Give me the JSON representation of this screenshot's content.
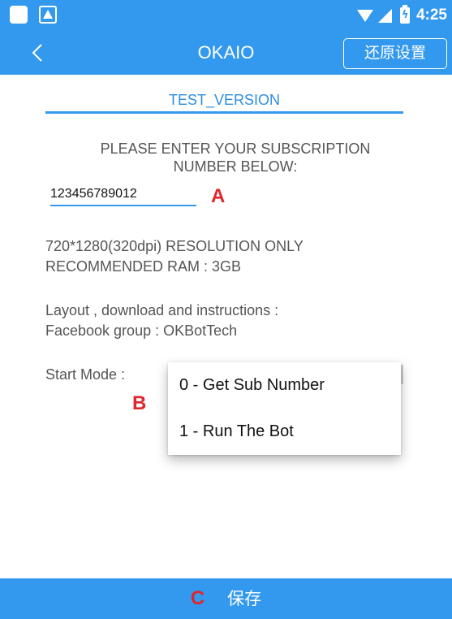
{
  "status_bar": {
    "time": "4:25",
    "icons": [
      "app-square-icon",
      "notification-icon",
      "wifi-icon",
      "signal-icon",
      "battery-icon"
    ]
  },
  "app_bar": {
    "title": "OKAIO",
    "back_icon": "chevron-left-icon",
    "reset_label": "还原设置"
  },
  "form": {
    "version_label": "TEST_VERSION",
    "instruction_line1": "PLEASE ENTER YOUR SUBSCRIPTION",
    "instruction_line2": "NUMBER BELOW:",
    "subscription_value": "123456789012",
    "resolution_note": "720*1280(320dpi) RESOLUTION ONLY",
    "ram_note": "RECOMMENDED RAM : 3GB",
    "layout_note": "Layout , download and instructions :",
    "facebook_note": "Facebook group : OKBotTech",
    "start_mode_label": "Start Mode  :"
  },
  "dropdown": {
    "options": [
      "0 - Get Sub Number",
      "1 - Run The Bot"
    ]
  },
  "markers": {
    "a": "A",
    "b": "B",
    "c": "C"
  },
  "footer": {
    "save_label": "保存"
  },
  "colors": {
    "primary": "#3399ee",
    "marker_red": "#e0262d",
    "text_gray": "#555555"
  }
}
